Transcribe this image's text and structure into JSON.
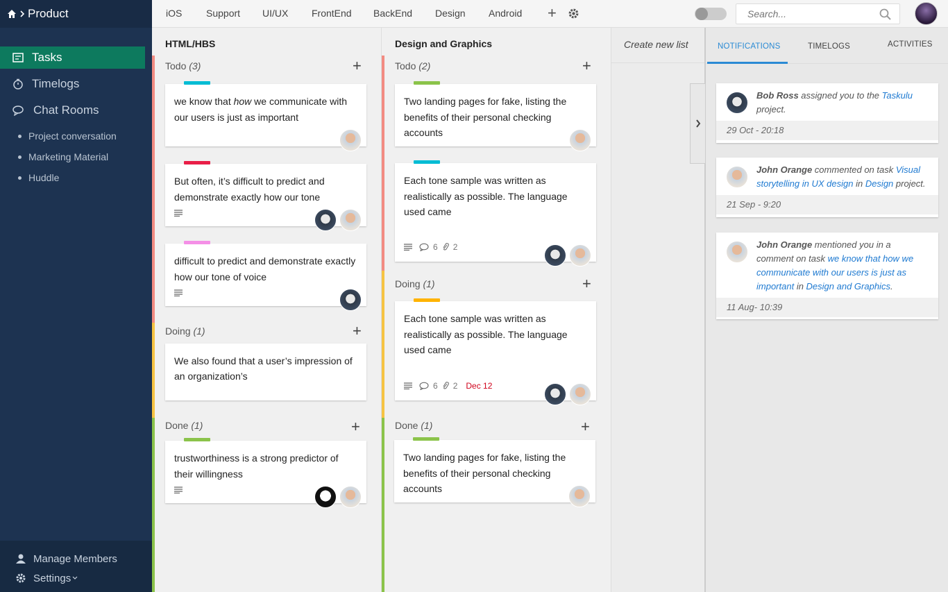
{
  "brand": {
    "title": "Product"
  },
  "sidebar": {
    "nav": [
      {
        "label": "Tasks"
      },
      {
        "label": "Timelogs"
      },
      {
        "label": "Chat Rooms"
      }
    ],
    "rooms": [
      {
        "label": "Project conversation"
      },
      {
        "label": "Marketing Material"
      },
      {
        "label": "Huddle"
      }
    ],
    "bottom": {
      "manage": "Manage Members",
      "settings": "Settings"
    }
  },
  "topbar": {
    "tabs": [
      "iOS",
      "Support",
      "UI/UX",
      "FrontEnd",
      "BackEnd",
      "Design",
      "Android"
    ],
    "add_label": "+",
    "search_placeholder": "Search..."
  },
  "board": {
    "columns": [
      {
        "title": "HTML/HBS",
        "groups": [
          {
            "name": "Todo",
            "count": "(3)",
            "color": "#f28b82",
            "cards": [
              {
                "text_pre": "we know that ",
                "text_em": "how",
                "text_post": " we communicate with our users is just as important",
                "label_color": "#00bcd4"
              },
              {
                "text": "But often, it’s difficult to predict and demonstrate exactly how our tone",
                "label_color": "#e91e47"
              },
              {
                "text": "difficult to predict and demonstrate exactly how our tone of voice",
                "label_color": "#f48fe6"
              }
            ]
          },
          {
            "name": "Doing",
            "count": "(1)",
            "color": "#f6c343",
            "cards": [
              {
                "text": "We also found that a user’s impression of an organization’s"
              }
            ]
          },
          {
            "name": "Done",
            "count": "(1)",
            "color": "#8bc34a",
            "cards": [
              {
                "text": "trustworthiness is a strong predictor of their willingness",
                "label_color": "#8bc34a"
              }
            ]
          }
        ]
      },
      {
        "title": "Design and Graphics",
        "groups": [
          {
            "name": "Todo",
            "count": "(2)",
            "color": "#f28b82",
            "cards": [
              {
                "text": "Two landing pages for fake, listing the benefits of their personal checking accounts",
                "label_color": "#8bc34a"
              },
              {
                "text": "Each tone sample was written as realistically as possible. The language used came",
                "label_color": "#00bcd4",
                "comments": "6",
                "attachments": "2"
              }
            ]
          },
          {
            "name": "Doing",
            "count": "(1)",
            "color": "#f6c343",
            "cards": [
              {
                "text": "Each tone sample was written as realistically as possible. The language used came",
                "label_color": "#ffb300",
                "comments": "6",
                "attachments": "2",
                "due": "Dec 12"
              }
            ]
          },
          {
            "name": "Done",
            "count": "(1)",
            "color": "#8bc34a",
            "cards": [
              {
                "text": "Two landing pages for fake, listing the benefits of their personal checking accounts",
                "label_color": "#8bc34a"
              }
            ]
          }
        ]
      }
    ],
    "create_list": "Create new list"
  },
  "panel": {
    "tabs": [
      "NOTIFICATIONS",
      "TIMELOGS",
      "ACTIVITIES"
    ],
    "notifications": [
      {
        "user": "Bob Ross",
        "t1": " assigned you to the ",
        "link1": "Taskulu",
        "t2": " project.",
        "time": "29 Oct - 20:18"
      },
      {
        "user": "John Orange",
        "t1": " commented on task ",
        "link1": "Visual storytelling in UX design",
        "t2": " in ",
        "link2": "Design",
        "t3": " project.",
        "time": "21 Sep - 9:20"
      },
      {
        "user": "John Orange",
        "t1": " mentioned you in a comment on task ",
        "link1": "we know that how we communicate with our users is just as important",
        "t2": " in ",
        "link2": "Design and Graphics",
        "t3": ".",
        "time": "11 Aug- 10:39"
      }
    ]
  },
  "colors": {
    "sidebar": "#1d3351",
    "active": "#0d7a5e",
    "accent": "#2a8ad4",
    "due": "#d0021b"
  }
}
